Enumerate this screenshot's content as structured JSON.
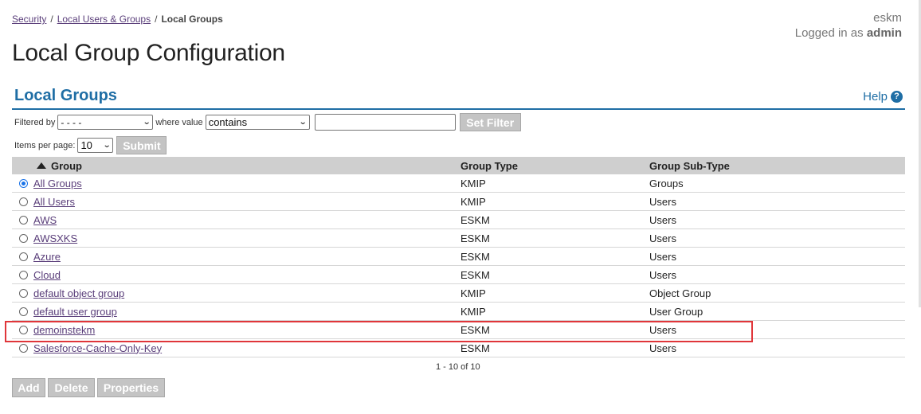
{
  "breadcrumb": {
    "items": [
      "Security",
      "Local Users & Groups"
    ],
    "separator": "/",
    "current": "Local Groups"
  },
  "user": {
    "host": "eskm",
    "logged_in_prefix": "Logged in as",
    "username": "admin"
  },
  "page_title": "Local Group Configuration",
  "section": {
    "title": "Local Groups",
    "help_label": "Help",
    "help_icon_glyph": "?"
  },
  "filter": {
    "filtered_by_label": "Filtered by",
    "filtered_by_value": "- - - -",
    "where_value_label": "where value",
    "operator_value": "contains",
    "text_value": "",
    "set_filter_label": "Set Filter"
  },
  "paging": {
    "items_per_page_label": "Items per page:",
    "items_per_page_value": "10",
    "submit_label": "Submit",
    "summary": "1 - 10 of 10"
  },
  "table": {
    "columns": [
      "Group",
      "Group Type",
      "Group Sub-Type"
    ],
    "sorted_column": "Group",
    "sort_direction": "ascending",
    "rows": [
      {
        "group": "All Groups",
        "type": "KMIP",
        "subtype": "Groups",
        "selected": true
      },
      {
        "group": "All Users",
        "type": "KMIP",
        "subtype": "Users",
        "selected": false
      },
      {
        "group": "AWS",
        "type": "ESKM",
        "subtype": "Users",
        "selected": false
      },
      {
        "group": "AWSXKS",
        "type": "ESKM",
        "subtype": "Users",
        "selected": false
      },
      {
        "group": "Azure",
        "type": "ESKM",
        "subtype": "Users",
        "selected": false
      },
      {
        "group": "Cloud",
        "type": "ESKM",
        "subtype": "Users",
        "selected": false
      },
      {
        "group": "default object group",
        "type": "KMIP",
        "subtype": "Object Group",
        "selected": false
      },
      {
        "group": "default user group",
        "type": "KMIP",
        "subtype": "User Group",
        "selected": false
      },
      {
        "group": "demoinstekm",
        "type": "ESKM",
        "subtype": "Users",
        "selected": false,
        "highlighted": true
      },
      {
        "group": "Salesforce-Cache-Only-Key",
        "type": "ESKM",
        "subtype": "Users",
        "selected": false
      }
    ]
  },
  "actions": {
    "add_label": "Add",
    "delete_label": "Delete",
    "properties_label": "Properties"
  },
  "colors": {
    "accent": "#1f6ea5",
    "link": "#5a3e7a",
    "highlight_border": "#e0363a",
    "header_bg": "#cfcfcf",
    "disabled_button": "#c4c4c4"
  }
}
